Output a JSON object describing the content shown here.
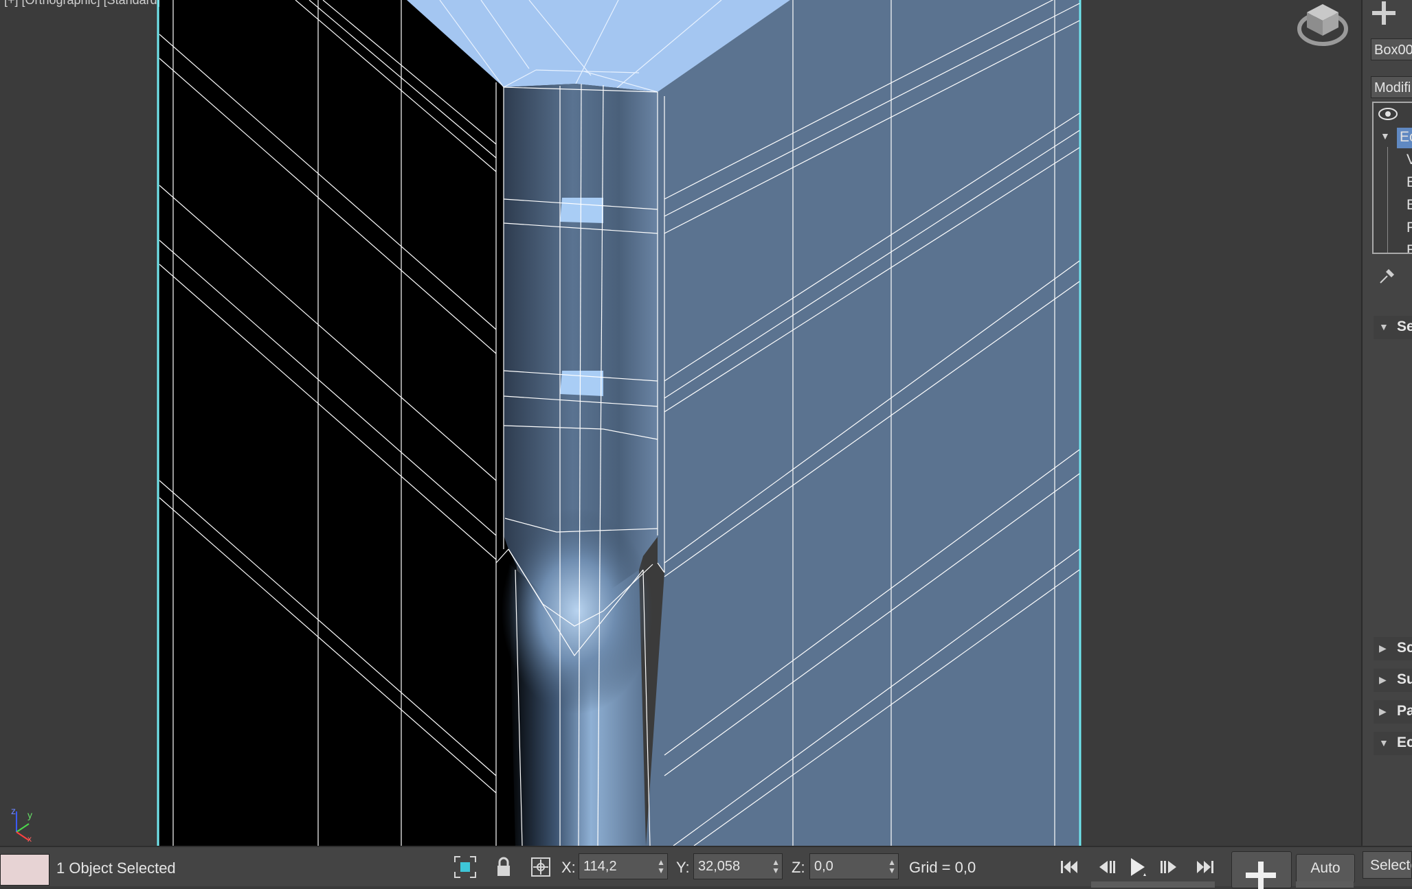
{
  "viewport": {
    "label": "[+] [Orthographic] [Standard] [Edged Faces]"
  },
  "command_panel": {
    "create_icon": "plus-icon",
    "object_name": "Box00",
    "modifier_list": "Modifi",
    "stack_items": [
      "Ec",
      "V",
      "E",
      "B",
      "P",
      "E"
    ],
    "rollouts": [
      {
        "label": "Se",
        "expanded": true
      },
      {
        "label": "Sc",
        "expanded": false
      },
      {
        "label": "Su",
        "expanded": false
      },
      {
        "label": "Pa",
        "expanded": false
      },
      {
        "label": "Ec",
        "expanded": true
      }
    ]
  },
  "status_bar": {
    "selection": "1 Object Selected",
    "x_label": "X:",
    "x_value": "114,2",
    "y_label": "Y:",
    "y_value": "32,058",
    "z_label": "Z:",
    "z_value": "0,0",
    "grid": "Grid = 0,0",
    "auto_key": "Auto",
    "selection_set": "Selecte"
  },
  "colors": {
    "viewport_bg": "#3b3b3b",
    "object_front": "#5b7390",
    "object_top": "#a4c6f1",
    "selection_bracket": "#6fe4ec",
    "ui_panel": "#444444"
  }
}
